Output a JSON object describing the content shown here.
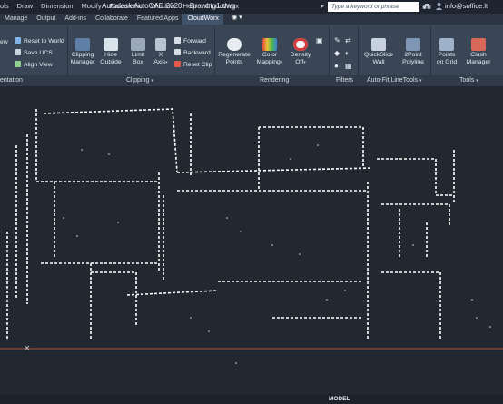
{
  "titlebar": {
    "menu": [
      "ols",
      "Draw",
      "Dimension",
      "Modify",
      "Parametric",
      "Window",
      "Help",
      "CloudWorx"
    ],
    "app_title": "Autodesk AutoCAD 2020",
    "file_name": "Drawing1.dwg",
    "search_placeholder": "Type a keyword or phrase",
    "user": "info@soffice.lt"
  },
  "tabs": [
    "Manage",
    "Output",
    "Add-ins",
    "Collaborate",
    "Featured Apps",
    "CloudWorx"
  ],
  "active_tab": "CloudWorx",
  "ribbon": {
    "ucs": {
      "reset_to_world": "Reset to World",
      "save_ucs": "Save UCS",
      "align_view": "Align View",
      "partial_left": "ew",
      "group_label": "entation"
    },
    "clipping": {
      "clipping_manager": [
        "Clipping",
        "Manager"
      ],
      "hide_outside": [
        "Hide",
        "Outside"
      ],
      "limit_box": [
        "Limit",
        "Box"
      ],
      "x_axis": [
        "X",
        "Axis"
      ],
      "forward": "Forward",
      "backward": "Backward",
      "reset_clip": "Reset Clip",
      "group_label": "Clipping"
    },
    "rendering": {
      "regenerate_points": [
        "Regenerate",
        "Points"
      ],
      "color_mapping": [
        "Color",
        "Mapping"
      ],
      "density_off": [
        "Density",
        "Off"
      ],
      "group_label": "Rendering"
    },
    "filters": {
      "group_label": "Filters"
    },
    "autofit": {
      "quickslice_wall": [
        "QuickSlice",
        "Wall"
      ],
      "twopoint_polyline": [
        "2Point",
        "Polyline"
      ],
      "group_label": "Auto-Fit LineTools"
    },
    "tools": {
      "points_on_grid": [
        "Points",
        "on Grid"
      ],
      "clash_manager": [
        "Clash",
        "Manager"
      ],
      "group_label": "Tools"
    }
  },
  "statusbar": {
    "model": "MODEL"
  },
  "colors": {
    "accent_active_tab": "#41546c",
    "background": "#212830",
    "point_cloud": "#ffffff",
    "x_axis_line": "#b5553a"
  },
  "icons": [
    "search-icon",
    "binoculars-icon",
    "user-icon",
    "cart-icon",
    "close-icon",
    "camera-icon"
  ]
}
